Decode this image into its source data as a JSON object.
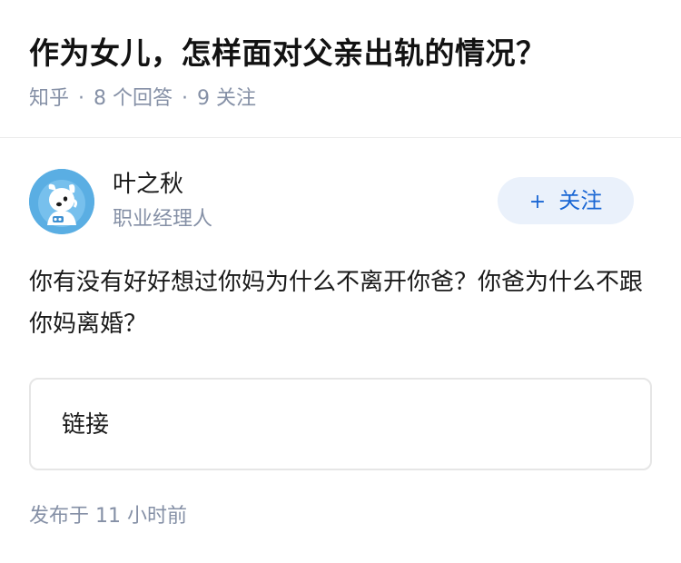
{
  "question": {
    "title": "作为女儿，怎样面对父亲出轨的情况？",
    "source": "知乎",
    "separator": "·",
    "answer_count": "8 个回答",
    "follower_count": "9 关注"
  },
  "author": {
    "name": "叶之秋",
    "headline": "职业经理人",
    "avatar_icon": "dog-astronaut-avatar"
  },
  "follow_button": {
    "icon": "+",
    "label": "关注"
  },
  "answer": {
    "content": "你有没有好好想过你妈为什么不离开你爸？你爸为什么不跟你妈离婚？",
    "link_card_label": "链接",
    "publish_time": "发布于 11 小时前"
  },
  "colors": {
    "accent": "#1966d4",
    "button_bg": "#eaf1fb",
    "meta_text": "#8590a6",
    "divider": "#ebebeb"
  }
}
